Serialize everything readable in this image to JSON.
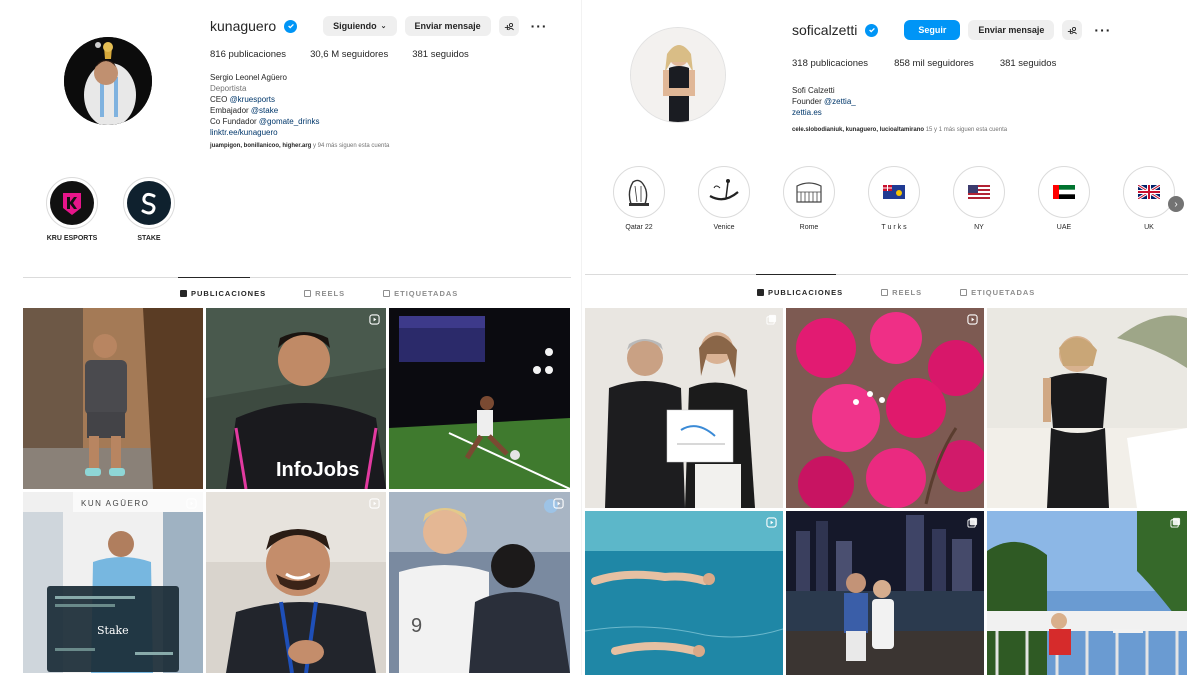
{
  "left": {
    "username": "kunaguero",
    "buttons": {
      "following": "Siguiendo",
      "message": "Enviar mensaje"
    },
    "stats": {
      "posts": "816 publicaciones",
      "followers": "30,6 M seguidores",
      "following": "381 seguidos"
    },
    "bio": {
      "name": "Sergio Leonel Agüero",
      "category": "Deportista",
      "line1_prefix": "CEO ",
      "line1_link": "@kruesports",
      "line2_prefix": "Embajador ",
      "line2_link": "@stake",
      "line3_prefix": "Co Fundador ",
      "line3_link": "@gomate_drinks",
      "website": "linktr.ee/kunaguero"
    },
    "followed_by": {
      "names": "juampigon, bonillanicoo, higher.arg",
      "suffix": " y 94 más siguen esta cuenta"
    },
    "highlights": [
      {
        "label": "KRU ESPORTS",
        "icon": "kru-logo"
      },
      {
        "label": "STAKE",
        "icon": "stake-logo"
      }
    ],
    "tabs": [
      "PUBLICACIONES",
      "REELS",
      "ETIQUETADAS"
    ],
    "posts": [
      {
        "desc": "man in grey outfit in hallway",
        "badge": "none"
      },
      {
        "desc": "player in black infojobs shirt",
        "badge": "reel",
        "text": "InfoJobs"
      },
      {
        "desc": "kick on indoor pitch",
        "badge": "none"
      },
      {
        "desc": "locker room with stake ticket",
        "badge": "reel",
        "text": "KUN AGÜERO",
        "overlay": "Stake"
      },
      {
        "desc": "smiling man with lanyard",
        "badge": "reel"
      },
      {
        "desc": "player embrace",
        "badge": "reel"
      }
    ]
  },
  "right": {
    "username": "soficalzetti",
    "buttons": {
      "follow": "Seguir",
      "message": "Enviar mensaje"
    },
    "stats": {
      "posts": "318 publicaciones",
      "followers": "858 mil seguidores",
      "following": "381 seguidos"
    },
    "bio": {
      "name": "Sofi Calzetti",
      "line1_prefix": "Founder ",
      "line1_link": "@zettia_",
      "website": "zettia.es"
    },
    "followed_by": {
      "names": "cele.slobodianiuk, kunaguero, lucioaltamirano",
      "suffix": " 15 y 1 más siguen esta cuenta"
    },
    "highlights": [
      {
        "label": "Qatar 22",
        "icon": "qatar-sketch"
      },
      {
        "label": "Venice",
        "icon": "gondola-sketch"
      },
      {
        "label": "Rome",
        "icon": "colosseum-sketch"
      },
      {
        "label": "T u r k s",
        "icon": "turks-flag"
      },
      {
        "label": "NY",
        "icon": "us-flag"
      },
      {
        "label": "UAE",
        "icon": "uae-flag"
      },
      {
        "label": "UK",
        "icon": "uk-flag"
      }
    ],
    "tabs": [
      "PUBLICACIONES",
      "REELS",
      "ETIQUETADAS"
    ],
    "posts": [
      {
        "desc": "man and woman with diploma",
        "badge": "carousel"
      },
      {
        "desc": "pink bougainvillea",
        "badge": "reel"
      },
      {
        "desc": "woman in black top on terrace",
        "badge": "none"
      },
      {
        "desc": "swimming underwater",
        "badge": "reel"
      },
      {
        "desc": "couple at night by water",
        "badge": "carousel"
      },
      {
        "desc": "woman in red on balcony",
        "badge": "carousel"
      }
    ]
  },
  "colors": {
    "accent": "#0095f6",
    "text": "#262626",
    "muted": "#737373",
    "link": "#00376b"
  }
}
